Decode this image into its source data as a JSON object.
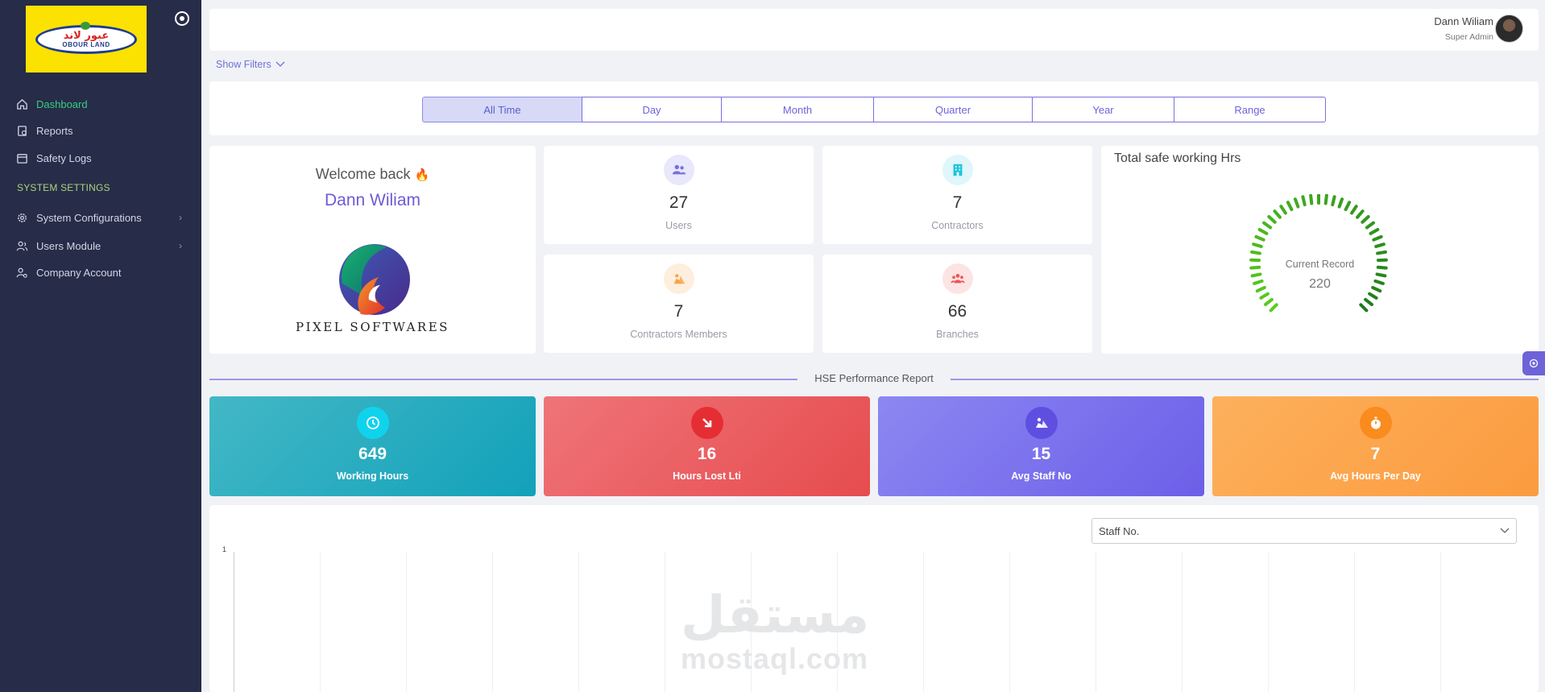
{
  "brand": {
    "logo_arabic": "عبور لاند",
    "logo_english": "OBOUR LAND"
  },
  "sidebar": {
    "items": [
      {
        "label": "Dashboard",
        "icon": "home-icon",
        "active": true
      },
      {
        "label": "Reports",
        "icon": "report-icon"
      },
      {
        "label": "Safety Logs",
        "icon": "calendar-icon"
      }
    ],
    "section_title": "SYSTEM SETTINGS",
    "settings_items": [
      {
        "label": "System Configurations",
        "icon": "gear-icon",
        "has_submenu": true
      },
      {
        "label": "Users Module",
        "icon": "users-icon",
        "has_submenu": true
      },
      {
        "label": "Company Account",
        "icon": "company-account-icon"
      }
    ]
  },
  "header": {
    "user_name": "Dann Wiliam",
    "user_role": "Super Admin"
  },
  "filters": {
    "toggle_label": "Show Filters",
    "time_ranges": [
      "All Time",
      "Day",
      "Month",
      "Quarter",
      "Year",
      "Range"
    ],
    "selected": "All Time"
  },
  "welcome": {
    "title": "Welcome back",
    "emoji": "🔥",
    "name": "Dann Wiliam",
    "company_logo_text": "PIXEL SOFTWARES"
  },
  "stats": [
    {
      "value": "27",
      "label": "Users",
      "icon": "users-icon",
      "color": "#7b6fe0"
    },
    {
      "value": "7",
      "label": "Contractors",
      "icon": "building-icon",
      "color": "#1bc5e0"
    },
    {
      "value": "7",
      "label": "Contractors Members",
      "icon": "worker-icon",
      "color": "#fba34a"
    },
    {
      "value": "66",
      "label": "Branches",
      "icon": "people-group-icon",
      "color": "#ef5350"
    }
  ],
  "gauge": {
    "title": "Total safe working Hrs",
    "label": "Current Record",
    "value": "220",
    "color": "#2ab21e"
  },
  "performance": {
    "title": "HSE Performance Report",
    "kpis": [
      {
        "value": "649",
        "label": "Working Hours",
        "icon": "clock-icon",
        "color": "#22a6bd"
      },
      {
        "value": "16",
        "label": "Hours Lost Lti",
        "icon": "arrow-down-right-icon",
        "color": "#e8545a"
      },
      {
        "value": "15",
        "label": "Avg Staff No",
        "icon": "worker-icon",
        "color": "#7a70ef"
      },
      {
        "value": "7",
        "label": "Avg Hours Per Day",
        "icon": "stopwatch-icon",
        "color": "#fda14b"
      }
    ]
  },
  "chart": {
    "select_value": "Staff No.",
    "y_tick": "1"
  },
  "watermark": {
    "arabic": "مستقل",
    "english": "mostaql.com"
  }
}
